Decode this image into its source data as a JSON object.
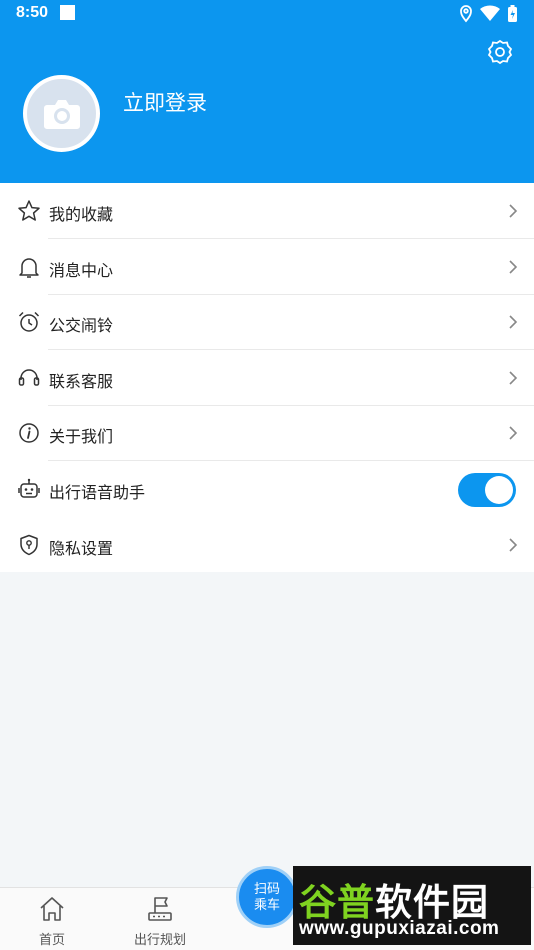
{
  "status_bar": {
    "time": "8:50"
  },
  "header": {
    "login_label": "立即登录"
  },
  "menu": {
    "items": [
      {
        "label": "我的收藏",
        "icon": "star-icon"
      },
      {
        "label": "消息中心",
        "icon": "bell-icon"
      },
      {
        "label": "公交闹铃",
        "icon": "alarm-clock-icon"
      },
      {
        "label": "联系客服",
        "icon": "headset-icon"
      },
      {
        "label": "关于我们",
        "icon": "info-icon"
      },
      {
        "label": "出行语音助手",
        "icon": "robot-icon",
        "toggle": true
      },
      {
        "label": "隐私设置",
        "icon": "shield-icon"
      }
    ]
  },
  "bottom_nav": {
    "home_label": "首页",
    "trip_label": "出行规划",
    "scan_line1": "扫码",
    "scan_line2": "乘车"
  },
  "watermark": {
    "text_part1": "谷普",
    "text_part2": "软件园",
    "url": "www.gupuxiazai.com"
  },
  "colors": {
    "brand": "#0c96ef",
    "background": "#f3f6f8"
  }
}
